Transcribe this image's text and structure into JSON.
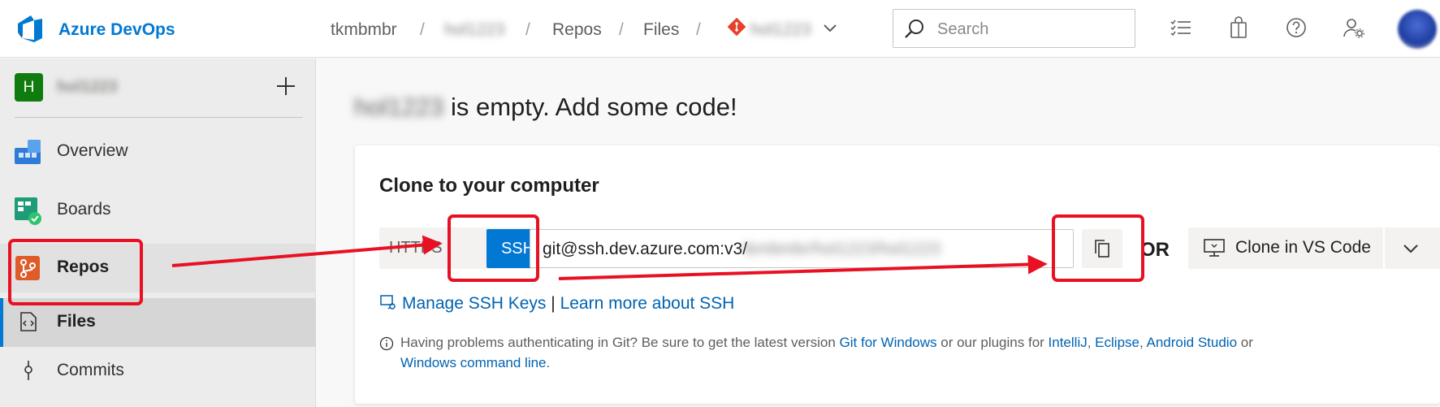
{
  "header": {
    "brand": "Azure DevOps",
    "breadcrumbs": {
      "org": "tkmbmbr",
      "project": "hol1223",
      "section": "Repos",
      "page": "Files",
      "repo": "hol1223",
      "separator": "/"
    },
    "search_placeholder": "Search",
    "icons": [
      "task-list-icon",
      "shopping-bag-icon",
      "help-icon",
      "user-settings-icon"
    ]
  },
  "sidebar": {
    "project_initial": "H",
    "project_name": "hol1223",
    "items": [
      {
        "label": "Overview",
        "icon": "overview-icon"
      },
      {
        "label": "Boards",
        "icon": "boards-icon"
      },
      {
        "label": "Repos",
        "icon": "repos-icon"
      },
      {
        "label": "Files",
        "icon": "files-icon"
      },
      {
        "label": "Commits",
        "icon": "commits-icon"
      }
    ]
  },
  "main": {
    "title_project": "hol1223",
    "title_suffix": " is empty. Add some code!",
    "clone_heading": "Clone to your computer",
    "protocol_https": "HTTPS",
    "protocol_ssh": "SSH",
    "url_visible": "git@ssh.dev.azure.com:v3/",
    "url_hidden": "tkmbmbr/hol1223/hol1223",
    "or_label": "OR",
    "clone_vs_label": "Clone in VS Code",
    "manage_ssh_keys": "Manage SSH Keys",
    "link_separator": " | ",
    "learn_ssh": "Learn more about SSH",
    "help_text_1": "Having problems authenticating in Git? Be sure to get the latest version ",
    "help_link_git": "Git for Windows",
    "help_text_2": " or our plugins for ",
    "help_link_intellij": "IntelliJ",
    "help_comma": ", ",
    "help_link_eclipse": "Eclipse",
    "help_link_android": "Android Studio",
    "help_text_3": " or ",
    "help_link_cmd": "Windows command line",
    "help_period": "."
  },
  "colors": {
    "accent": "#0078d4",
    "annotation": "#e81123",
    "project_tile": "#107c10",
    "link": "#0063b1"
  }
}
